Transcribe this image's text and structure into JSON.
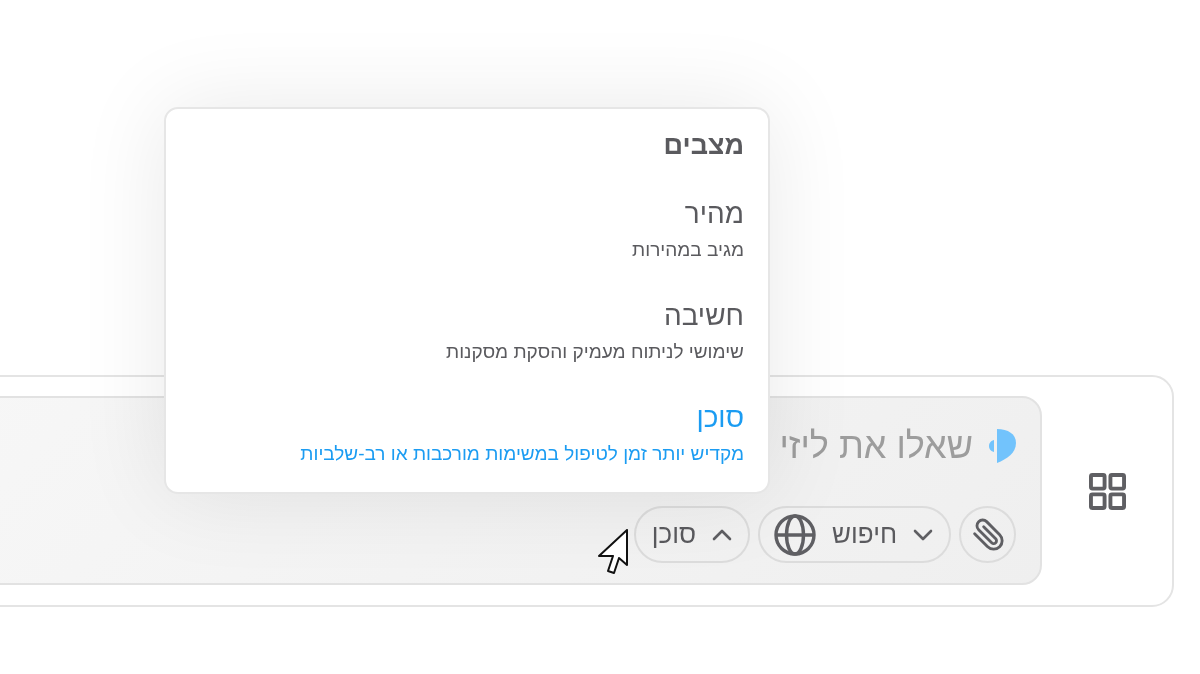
{
  "composer": {
    "placeholder": "שאלו את ליזי",
    "buttons": [
      {
        "kind": "attach"
      },
      {
        "kind": "search",
        "label": "חיפוש",
        "expanded": false
      },
      {
        "kind": "mode",
        "label": "סוכן",
        "expanded": true
      }
    ]
  },
  "mode_menu": {
    "title": "מצבים",
    "items": [
      {
        "label": "מהיר",
        "description": "מגיב במהירות",
        "selected": false
      },
      {
        "label": "חשיבה",
        "description": "שימושי לניתוח מעמיק והסקת מסקנות",
        "selected": false
      },
      {
        "label": "סוכן",
        "description": "מקדיש יותר זמן לטיפול במשימות מורכבות או רב-שלביות",
        "selected": true
      }
    ]
  }
}
